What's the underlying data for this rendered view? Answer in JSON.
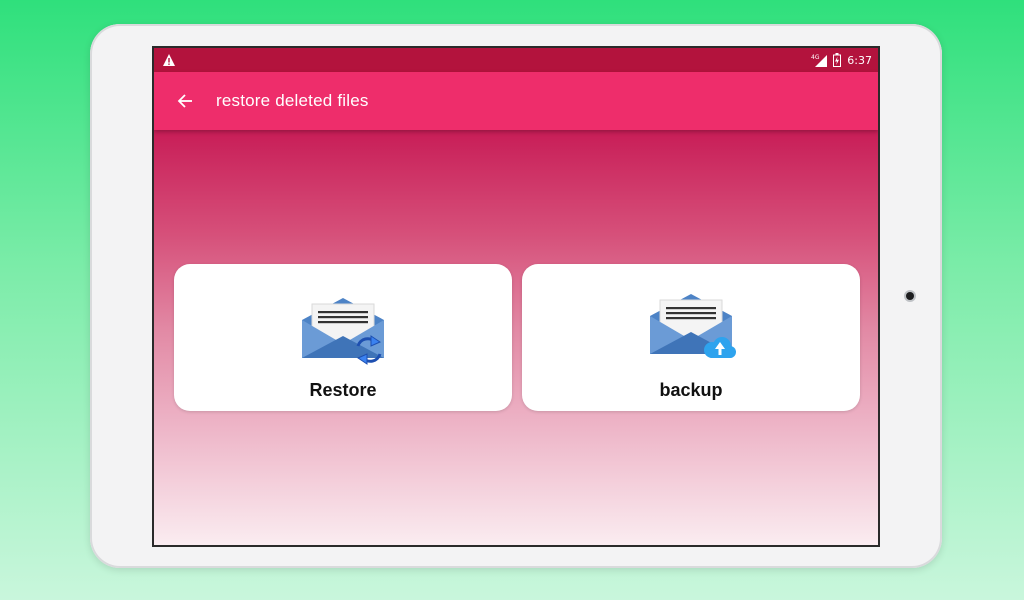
{
  "statusbar": {
    "left_icon": "warning-icon",
    "network_label": "4G",
    "signal_icon": "signal-icon",
    "battery_icon": "battery-charging-icon",
    "time": "6:37"
  },
  "appbar": {
    "back_icon": "arrow-back-icon",
    "title": "restore deleted files"
  },
  "cards": [
    {
      "label": "Restore",
      "icon": "envelope-restore-icon"
    },
    {
      "label": "backup",
      "icon": "envelope-cloud-upload-icon"
    }
  ],
  "colors": {
    "statusbar": "#b3133d",
    "appbar": "#ee2d6b",
    "background_top": "#c81d57",
    "background_bottom": "#fbeef2",
    "page_background": "#2fe07c"
  }
}
